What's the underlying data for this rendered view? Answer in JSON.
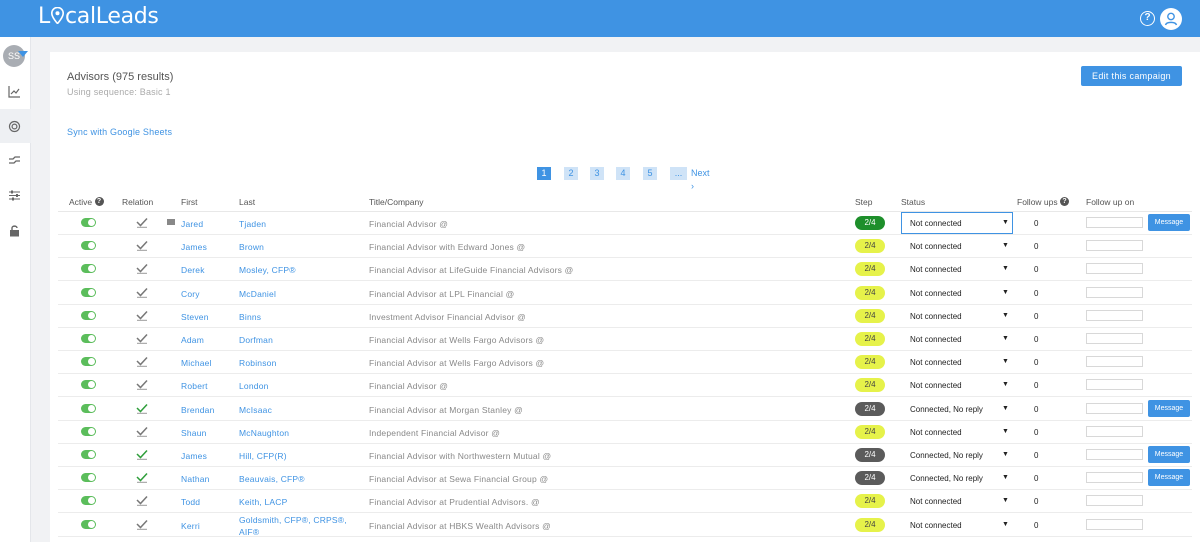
{
  "app": {
    "logo_text_1": "L",
    "logo_text_2": "calLeads"
  },
  "user": {
    "initials": "SS"
  },
  "header": {
    "title": "Advisors (975 results)",
    "subtitle": "Using sequence: Basic 1",
    "edit_button": "Edit this campaign",
    "sync_link": "Sync with Google Sheets"
  },
  "pagination": {
    "pages": [
      "1",
      "2",
      "3",
      "4",
      "5",
      "..."
    ],
    "current": "1",
    "next": "Next ›"
  },
  "table": {
    "columns": {
      "active": "Active",
      "relation": "Relation",
      "first": "First",
      "last": "Last",
      "title": "Title/Company",
      "step": "Step",
      "status": "Status",
      "followups": "Follow ups",
      "followup_on": "Follow up on"
    },
    "message_label": "Message",
    "rows": [
      {
        "first": "Jared",
        "last": "Tjaden",
        "title": "Financial Advisor @",
        "step": "2/4",
        "step_color": "green",
        "status": "Not connected",
        "followups": "0",
        "message": true,
        "mail": true,
        "selected": true
      },
      {
        "first": "James",
        "last": "Brown",
        "title": "Financial Advisor with Edward Jones @",
        "step": "2/4",
        "step_color": "yellow",
        "status": "Not connected",
        "followups": "0",
        "message": false
      },
      {
        "first": "Derek",
        "last": "Mosley, CFP®",
        "title": "Financial Advisor at LifeGuide Financial Advisors @",
        "step": "2/4",
        "step_color": "yellow",
        "status": "Not connected",
        "followups": "0",
        "message": false
      },
      {
        "first": "Cory",
        "last": "McDaniel",
        "title": "Financial Advisor at LPL Financial @",
        "step": "2/4",
        "step_color": "yellow",
        "status": "Not connected",
        "followups": "0",
        "message": false
      },
      {
        "first": "Steven",
        "last": "Binns",
        "title": "Investment Advisor Financial Advisor @",
        "step": "2/4",
        "step_color": "yellow",
        "status": "Not connected",
        "followups": "0",
        "message": false
      },
      {
        "first": "Adam",
        "last": "Dorfman",
        "title": "Financial Advisor at Wells Fargo Advisors @",
        "step": "2/4",
        "step_color": "yellow",
        "status": "Not connected",
        "followups": "0",
        "message": false
      },
      {
        "first": "Michael",
        "last": "Robinson",
        "title": "Financial Advisor at Wells Fargo Advisors @",
        "step": "2/4",
        "step_color": "yellow",
        "status": "Not connected",
        "followups": "0",
        "message": false
      },
      {
        "first": "Robert",
        "last": "London",
        "title": "Financial Advisor @",
        "step": "2/4",
        "step_color": "yellow",
        "status": "Not connected",
        "followups": "0",
        "message": false
      },
      {
        "first": "Brendan",
        "last": "McIsaac",
        "title": "Financial Advisor at Morgan Stanley @",
        "step": "2/4",
        "step_color": "gray",
        "status": "Connected, No reply",
        "followups": "0",
        "message": true
      },
      {
        "first": "Shaun",
        "last": "McNaughton",
        "title": "Independent Financial Advisor @",
        "step": "2/4",
        "step_color": "yellow",
        "status": "Not connected",
        "followups": "0",
        "message": false
      },
      {
        "first": "James",
        "last": "Hill, CFP(R)",
        "title": "Financial Advisor with Northwestern Mutual @",
        "step": "2/4",
        "step_color": "gray",
        "status": "Connected, No reply",
        "followups": "0",
        "message": true
      },
      {
        "first": "Nathan",
        "last": "Beauvais, CFP®",
        "title": "Financial Advisor at Sewa Financial Group @",
        "step": "2/4",
        "step_color": "gray",
        "status": "Connected, No reply",
        "followups": "0",
        "message": true
      },
      {
        "first": "Todd",
        "last": "Keith, LACP",
        "title": "Financial Advisor at Prudential Advisors. @",
        "step": "2/4",
        "step_color": "yellow",
        "status": "Not connected",
        "followups": "0",
        "message": false
      },
      {
        "first": "Kerri",
        "last": "Goldsmith, CFP®, CRPS®,",
        "last2": "AIF®",
        "title": "Financial Advisor at HBKS Wealth Advisors @",
        "step": "2/4",
        "step_color": "yellow",
        "status": "Not connected",
        "followups": "0",
        "message": false
      }
    ]
  }
}
